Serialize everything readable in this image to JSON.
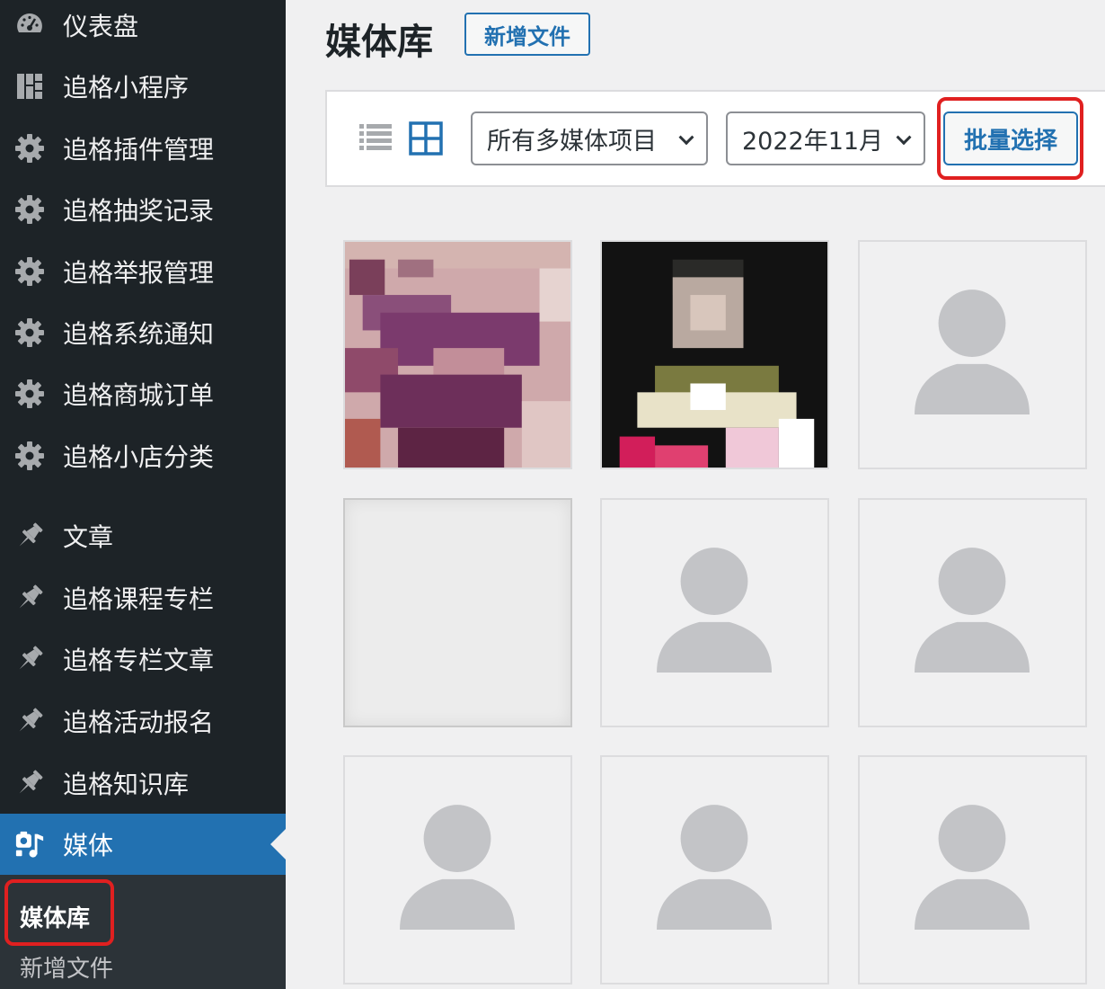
{
  "sidebar": {
    "items": [
      {
        "label": "仪表盘",
        "icon": "dashboard-icon"
      },
      {
        "label": "追格小程序",
        "icon": "grid-layout-icon"
      },
      {
        "label": "追格插件管理",
        "icon": "gear-icon"
      },
      {
        "label": "追格抽奖记录",
        "icon": "gear-icon"
      },
      {
        "label": "追格举报管理",
        "icon": "gear-icon"
      },
      {
        "label": "追格系统通知",
        "icon": "gear-icon"
      },
      {
        "label": "追格商城订单",
        "icon": "gear-icon"
      },
      {
        "label": "追格小店分类",
        "icon": "gear-icon"
      },
      {
        "label": "文章",
        "icon": "pin-icon"
      },
      {
        "label": "追格课程专栏",
        "icon": "pin-icon"
      },
      {
        "label": "追格专栏文章",
        "icon": "pin-icon"
      },
      {
        "label": "追格活动报名",
        "icon": "pin-icon"
      },
      {
        "label": "追格知识库",
        "icon": "pin-icon"
      },
      {
        "label": "媒体",
        "icon": "media-icon",
        "active": true
      }
    ],
    "submenu": [
      {
        "label": "媒体库",
        "current": true
      },
      {
        "label": "新增文件",
        "current": false
      }
    ]
  },
  "header": {
    "title": "媒体库",
    "add_new_label": "新增文件"
  },
  "toolbar": {
    "list_view_icon": "list-view-icon",
    "grid_view_icon": "grid-view-icon",
    "filter_type_value": "所有多媒体项目",
    "filter_date_value": "2022年11月",
    "bulk_select_label": "批量选择"
  },
  "media_grid": {
    "tiles": [
      {
        "kind": "image-pixelated-purple"
      },
      {
        "kind": "image-pixelated-dark"
      },
      {
        "kind": "placeholder-person"
      },
      {
        "kind": "blank"
      },
      {
        "kind": "placeholder-person"
      },
      {
        "kind": "placeholder-person"
      },
      {
        "kind": "placeholder-person"
      },
      {
        "kind": "placeholder-person"
      },
      {
        "kind": "placeholder-person"
      }
    ]
  },
  "colors": {
    "sidebar_bg": "#1d2327",
    "active_bg": "#2271b1",
    "accent": "#2271b1",
    "highlight_red": "#e02020"
  }
}
